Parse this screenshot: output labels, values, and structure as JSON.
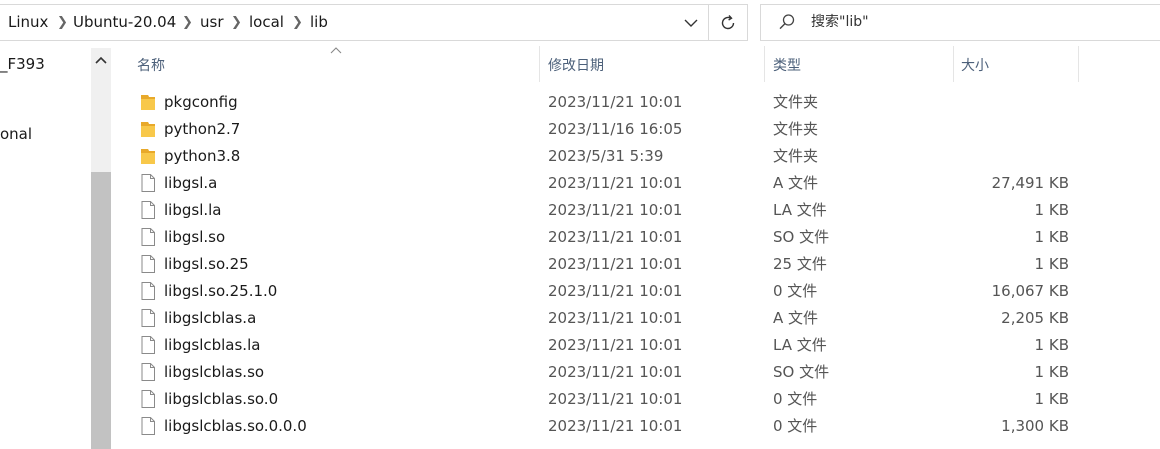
{
  "breadcrumb": [
    "Linux",
    "Ubuntu-20.04",
    "usr",
    "local",
    "lib"
  ],
  "search": {
    "placeholder": "搜索\"lib\""
  },
  "nav": {
    "items": [
      "_F393",
      "onal"
    ]
  },
  "columns": {
    "name": "名称",
    "date": "修改日期",
    "type": "类型",
    "size": "大小"
  },
  "files": [
    {
      "name": "pkgconfig",
      "date": "2023/11/21 10:01",
      "type": "文件夹",
      "size": "",
      "kind": "folder"
    },
    {
      "name": "python2.7",
      "date": "2023/11/16 16:05",
      "type": "文件夹",
      "size": "",
      "kind": "folder"
    },
    {
      "name": "python3.8",
      "date": "2023/5/31 5:39",
      "type": "文件夹",
      "size": "",
      "kind": "folder"
    },
    {
      "name": "libgsl.a",
      "date": "2023/11/21 10:01",
      "type": "A 文件",
      "size": "27,491 KB",
      "kind": "file"
    },
    {
      "name": "libgsl.la",
      "date": "2023/11/21 10:01",
      "type": "LA 文件",
      "size": "1 KB",
      "kind": "file"
    },
    {
      "name": "libgsl.so",
      "date": "2023/11/21 10:01",
      "type": "SO 文件",
      "size": "1 KB",
      "kind": "file"
    },
    {
      "name": "libgsl.so.25",
      "date": "2023/11/21 10:01",
      "type": "25 文件",
      "size": "1 KB",
      "kind": "file"
    },
    {
      "name": "libgsl.so.25.1.0",
      "date": "2023/11/21 10:01",
      "type": "0 文件",
      "size": "16,067 KB",
      "kind": "file"
    },
    {
      "name": "libgslcblas.a",
      "date": "2023/11/21 10:01",
      "type": "A 文件",
      "size": "2,205 KB",
      "kind": "file"
    },
    {
      "name": "libgslcblas.la",
      "date": "2023/11/21 10:01",
      "type": "LA 文件",
      "size": "1 KB",
      "kind": "file"
    },
    {
      "name": "libgslcblas.so",
      "date": "2023/11/21 10:01",
      "type": "SO 文件",
      "size": "1 KB",
      "kind": "file"
    },
    {
      "name": "libgslcblas.so.0",
      "date": "2023/11/21 10:01",
      "type": "0 文件",
      "size": "1 KB",
      "kind": "file"
    },
    {
      "name": "libgslcblas.so.0.0.0",
      "date": "2023/11/21 10:01",
      "type": "0 文件",
      "size": "1,300 KB",
      "kind": "file"
    }
  ],
  "colors": {
    "folder": "#f8c84a",
    "folderDark": "#e8a92a",
    "header": "#4c607a",
    "scrollThumb": "#c2c2c2"
  }
}
